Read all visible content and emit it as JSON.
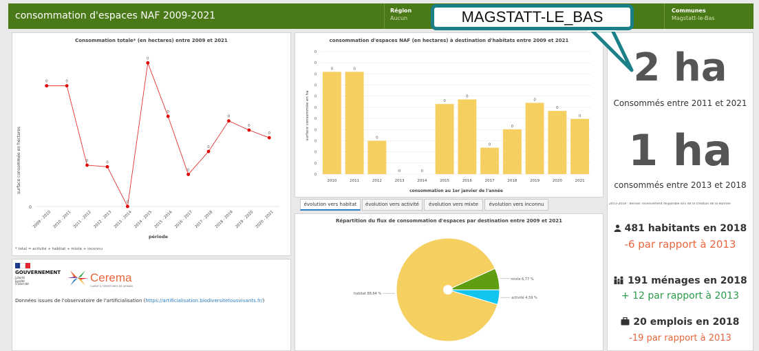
{
  "header": {
    "title": "consommation d'espaces NAF 2009-2021",
    "filters": [
      {
        "label": "Région",
        "value": "Aucun"
      },
      {
        "label": "Communes",
        "value": "Magstatt-le-Bas"
      }
    ]
  },
  "callout": {
    "text": "MAGSTATT-LE_BAS"
  },
  "total_chart": {
    "title": "Consommation totale* (en hectares) entre 2009 et 2021",
    "ylabel": "surface consommée en hectares",
    "xlabel": "période",
    "y_tick": "0",
    "footnote": "* total = activité + habitat + mixte + inconnu"
  },
  "habitat_chart": {
    "title": "consommation d'espaces NAF (en hectares) à destination d'habitats entre 2009 et 2021",
    "ylabel": "surface consommée en ha",
    "xlabel": "consommation au 1er janvier de l'année",
    "y_ticks": [
      "0",
      "0",
      "0",
      "0",
      "0",
      "0",
      "0",
      "0",
      "0",
      "0",
      "0",
      "0"
    ]
  },
  "tabs": [
    {
      "label": "évolution vers habitat",
      "active": true
    },
    {
      "label": "évolution vers activité",
      "active": false
    },
    {
      "label": "évolution vers mixte",
      "active": false
    },
    {
      "label": "évolution vers inconnu",
      "active": false
    }
  ],
  "pie_chart_title": "Répartition du flux de consommation d'espaces par destination entre 2009 et 2021",
  "chart_data": [
    {
      "type": "line",
      "title": "Consommation totale* (en hectares) entre 2009 et 2021",
      "xlabel": "période",
      "ylabel": "surface consommée en hectares",
      "categories": [
        "2009 - 2010",
        "2010 - 2011",
        "2011 - 2012",
        "2012 - 2013",
        "2013 - 2014",
        "2014 - 2015",
        "2015 - 2016",
        "2016 - 2017",
        "2017 - 2018",
        "2018 - 2019",
        "2019 - 2020",
        "2020 - 2021"
      ],
      "values": [
        0.79,
        0.79,
        0.27,
        0.26,
        0.0,
        0.94,
        0.59,
        0.21,
        0.36,
        0.56,
        0.5,
        0.45
      ],
      "labels": [
        "0",
        "0",
        "0",
        "0",
        "0",
        "0",
        "0",
        "0",
        "0",
        "0",
        "0",
        "0"
      ],
      "color": "#e23030"
    },
    {
      "type": "bar",
      "title": "consommation d'espaces NAF (en hectares) à destination d'habitats entre 2009 et 2021",
      "xlabel": "consommation au 1er janvier de l'année",
      "ylabel": "surface consommée en ha",
      "categories": [
        "2010",
        "2011",
        "2012",
        "2013",
        "2014",
        "2015",
        "2016",
        "2017",
        "2018",
        "2019",
        "2020",
        "2021"
      ],
      "values": [
        0.89,
        0.89,
        0.29,
        0.0,
        0.0,
        0.61,
        0.65,
        0.23,
        0.39,
        0.62,
        0.55,
        0.48
      ],
      "labels": [
        "0",
        "0",
        "0",
        "0",
        "0",
        "0",
        "0",
        "0",
        "0",
        "0",
        "0",
        "0"
      ],
      "color": "#f5cf5f"
    },
    {
      "type": "pie",
      "title": "Répartition du flux de consommation d'espaces par destination entre 2009 et 2021",
      "slices": [
        {
          "name": "habitat",
          "value": 88.64,
          "label": "habitat 88,64 %",
          "color": "#f5cf5f"
        },
        {
          "name": "mixte",
          "value": 6.77,
          "label": "mixte 6,77 %",
          "color": "#5f9e10"
        },
        {
          "name": "activité",
          "value": 4.59,
          "label": "activité 4,59 %",
          "color": "#12c4f0"
        }
      ]
    }
  ],
  "source": {
    "gov_label": "GOUVERNEMENT",
    "gov_motto": [
      "Liberté",
      "Égalité",
      "Fraternité"
    ],
    "brand": "Cerema",
    "brand_tagline": "CLIMAT & TERRITOIRES DE DEMAIN",
    "text_prefix": "Données issues de l'observatoire de l'artificialisation (",
    "link": "https://artificialisation.biodiversitetousvivants.fr/",
    "text_suffix": ")"
  },
  "kpis": {
    "total_value": "2 ha",
    "total_caption": "Consommés entre 2011 et 2021",
    "recent_value": "1 ha",
    "recent_caption": "consommés entre 2013 et 2018",
    "note": "2013-2018 : dernier recensement disponible lors de la création de la donnée",
    "habitants": "481 habitants en 2018",
    "habitants_delta": "-6 par rapport à 2013",
    "menages": "191 ménages en 2018",
    "menages_delta": "+ 12 par rapport à 2013",
    "emplois": "20 emplois en 2018",
    "emplois_delta": "-19 par rapport à 2013",
    "colors": {
      "negative": "#e8663c",
      "positive": "#2a9a4a"
    }
  }
}
